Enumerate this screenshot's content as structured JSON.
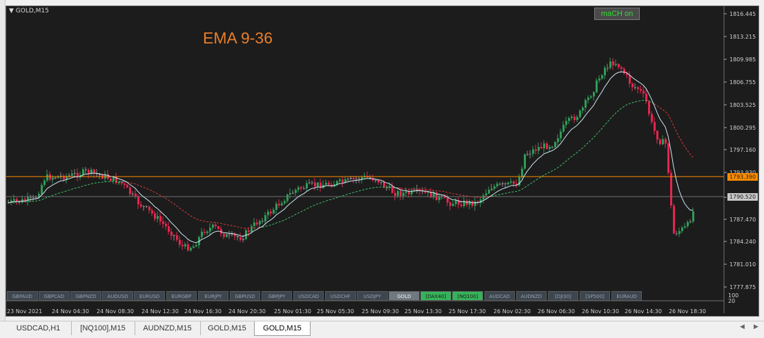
{
  "chart": {
    "symbol_title": "GOLD,M15",
    "indicator_label": "EMA 9-36",
    "status_button": "maCH on",
    "price_labels": [
      "1816.445",
      "1813.215",
      "1809.985",
      "1806.755",
      "1803.525",
      "1800.295",
      "1797.160",
      "1793.930",
      "1790.520",
      "1787.470",
      "1784.240",
      "1781.010",
      "1777.875"
    ],
    "sub_labels": [
      "100",
      "20"
    ],
    "current_price": "1793.390",
    "bid_price": "1790.520",
    "time_labels": [
      "23 Nov 2021",
      "24 Nov 04:30",
      "24 Nov 08:30",
      "24 Nov 12:30",
      "24 Nov 16:30",
      "24 Nov 20:30",
      "25 Nov 01:30",
      "25 Nov 05:30",
      "25 Nov 09:30",
      "25 Nov 13:30",
      "25 Nov 17:30",
      "26 Nov 02:30",
      "26 Nov 06:30",
      "26 Nov 10:30",
      "26 Nov 14:30",
      "26 Nov 18:30"
    ],
    "colors": {
      "background": "#1c1c1c",
      "bull": "#2e9d57",
      "bear": "#e8244e",
      "neutral": "#8a8a8a",
      "ema_fast": "#cfe8f6",
      "ema_slow_red": "#d93a3a",
      "ema_slow_green": "#3fbf6a",
      "hline": "#ff8c00",
      "label_orange": "#e87e2a"
    }
  },
  "symbol_buttons": [
    {
      "label": "GBPAUD",
      "state": "normal"
    },
    {
      "label": "GBPCAD",
      "state": "normal"
    },
    {
      "label": "GBPNZD",
      "state": "normal"
    },
    {
      "label": "AUDUSD",
      "state": "normal"
    },
    {
      "label": "EURUSD",
      "state": "normal"
    },
    {
      "label": "EURGBP",
      "state": "normal"
    },
    {
      "label": "EURJPY",
      "state": "normal"
    },
    {
      "label": "GBPUSD",
      "state": "normal"
    },
    {
      "label": "GBPJPY",
      "state": "normal"
    },
    {
      "label": "USDCAD",
      "state": "normal"
    },
    {
      "label": "USDCHF",
      "state": "normal"
    },
    {
      "label": "USDJPY",
      "state": "normal"
    },
    {
      "label": "GOLD",
      "state": "active"
    },
    {
      "label": "[DAX40]",
      "state": "green"
    },
    {
      "label": "[NQ100]",
      "state": "green"
    },
    {
      "label": "AUDCAD",
      "state": "normal"
    },
    {
      "label": "AUDNZD",
      "state": "normal"
    },
    {
      "label": "[DJI30]",
      "state": "normal"
    },
    {
      "label": "[SP500]",
      "state": "normal"
    },
    {
      "label": "EURAUD",
      "state": "normal"
    }
  ],
  "tabs": [
    {
      "label": "USDCAD,H1",
      "active": false
    },
    {
      "label": "[NQ100],M15",
      "active": false
    },
    {
      "label": "AUDNZD,M15",
      "active": false
    },
    {
      "label": "GOLD,M15",
      "active": false
    },
    {
      "label": "GOLD,M15",
      "active": true
    }
  ],
  "icons": {
    "menu": "triangle-down-icon",
    "scroll_left": "arrow-left-icon",
    "scroll_right": "arrow-right-icon"
  }
}
